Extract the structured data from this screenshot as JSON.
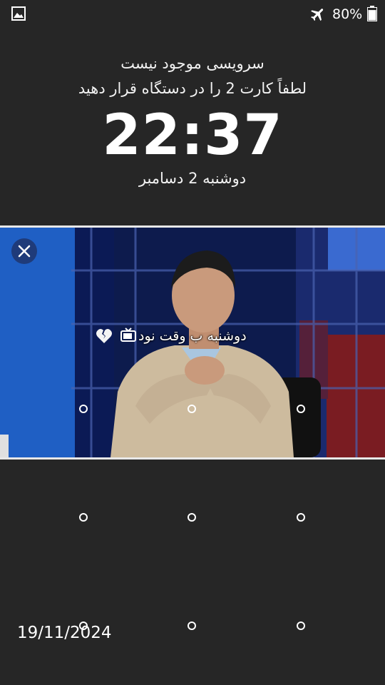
{
  "status_bar": {
    "battery_percent": "80%",
    "battery_level": 0.8,
    "icons": [
      "gallery-icon",
      "airplane-mode-icon",
      "battery-icon"
    ]
  },
  "lock_screen": {
    "carrier_line_1": "سرویسی موجود نیست",
    "carrier_line_2": "لطفاً کارت 2 را در دستگاه قرار دهید",
    "time": "22:37",
    "date": "دوشنبه 2 دسامبر"
  },
  "notification_banner": {
    "caption": "دوشنبه ب وقت نود",
    "icons": [
      "close-icon",
      "tv-icon",
      "broken-heart-icon"
    ]
  },
  "pattern_lock": {
    "dots": 9
  },
  "watermark": {
    "date": "19/11/2024"
  },
  "colors": {
    "background": "#262626",
    "close_button": "#1f3b7a",
    "banner_border": "#e8e8e8"
  }
}
